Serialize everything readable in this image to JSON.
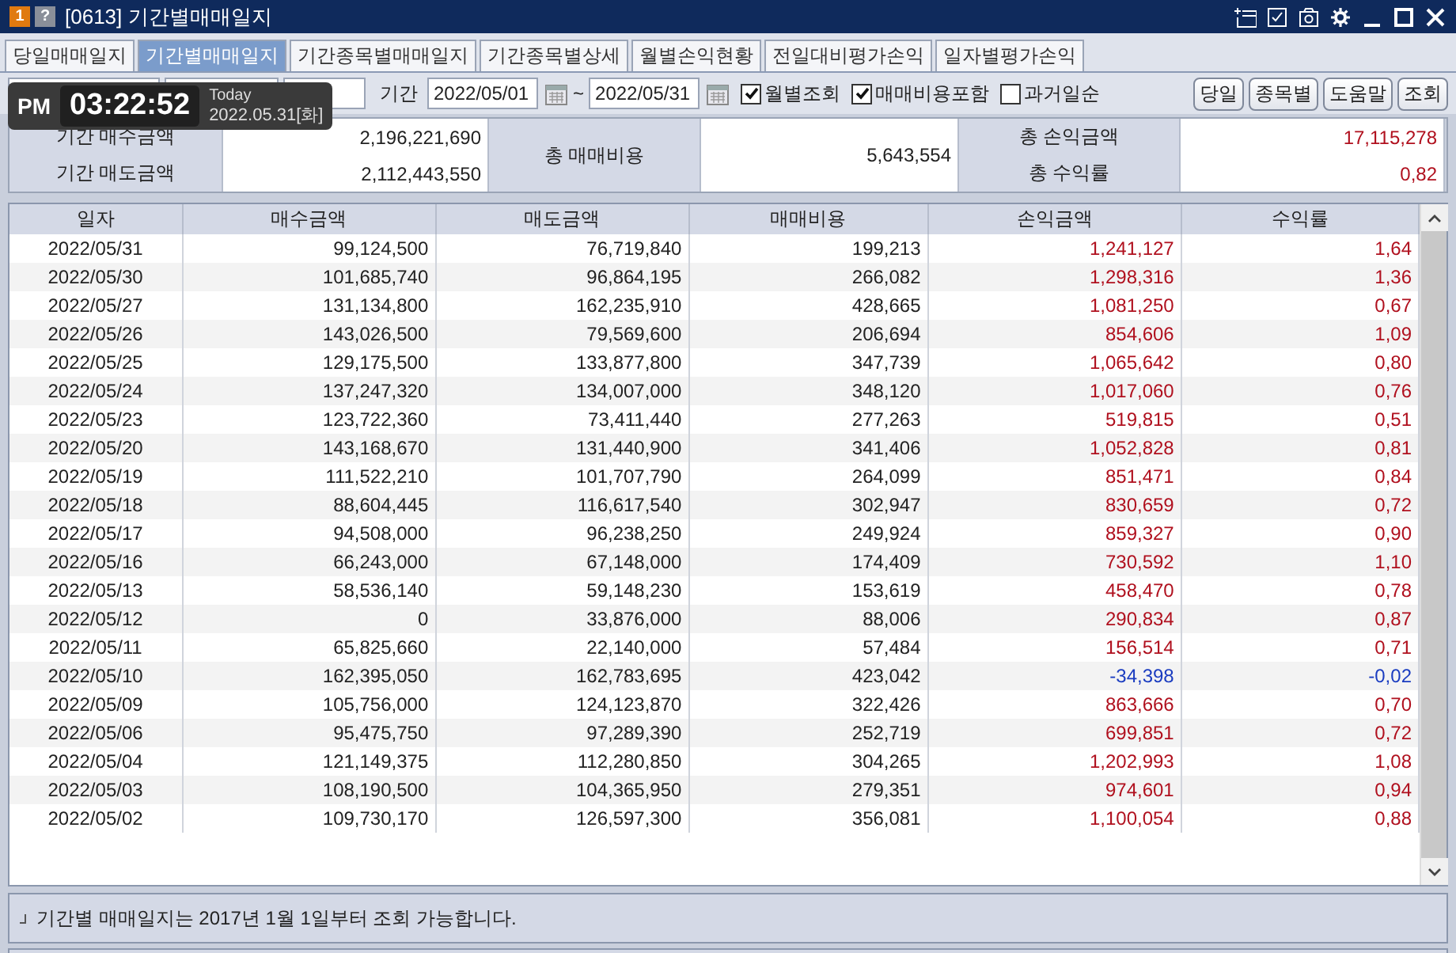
{
  "window": {
    "badge": "1",
    "help": "?",
    "title": "[0613] 기간별매매일지"
  },
  "tabs": [
    {
      "label": "당일매매일지",
      "selected": false
    },
    {
      "label": "기간별매매일지",
      "selected": true
    },
    {
      "label": "기간종목별매매일지",
      "selected": false
    },
    {
      "label": "기간종목별상세",
      "selected": false
    },
    {
      "label": "월별손익현황",
      "selected": false
    },
    {
      "label": "전일대비평가손익",
      "selected": false
    },
    {
      "label": "일자별평가손익",
      "selected": false
    }
  ],
  "clock": {
    "ampm": "PM",
    "time": "03:22:52",
    "caption": "Today",
    "date": "2022.05.31[화]"
  },
  "toolbar": {
    "period_label": "기간",
    "from": "2022/05/01",
    "separator": "~",
    "to": "2022/05/31",
    "checkboxes": [
      {
        "label": "월별조회",
        "checked": true
      },
      {
        "label": "매매비용포함",
        "checked": true
      },
      {
        "label": "과거일순",
        "checked": false
      }
    ],
    "buttons": [
      "당일",
      "종목별",
      "도움말",
      "조회"
    ]
  },
  "summary": {
    "buy_label": "기간 매수금액",
    "buy_value": "2,196,221,690",
    "sell_label": "기간 매도금액",
    "sell_value": "2,112,443,550",
    "cost_label": "총 매매비용",
    "cost_value": "5,643,554",
    "pnl_label": "총 손익금액",
    "pnl_value": "17,115,278",
    "rate_label": "총 수익률",
    "rate_value": "0,82",
    "loss": false
  },
  "table": {
    "columns": [
      "일자",
      "매수금액",
      "매도금액",
      "매매비용",
      "손익금액",
      "수익률"
    ],
    "rows": [
      {
        "cells": [
          "2022/05/31",
          "99,124,500",
          "76,719,840",
          "199,213",
          "1,241,127",
          "1,64"
        ],
        "loss": false
      },
      {
        "cells": [
          "2022/05/30",
          "101,685,740",
          "96,864,195",
          "266,082",
          "1,298,316",
          "1,36"
        ],
        "loss": false
      },
      {
        "cells": [
          "2022/05/27",
          "131,134,800",
          "162,235,910",
          "428,665",
          "1,081,250",
          "0,67"
        ],
        "loss": false
      },
      {
        "cells": [
          "2022/05/26",
          "143,026,500",
          "79,569,600",
          "206,694",
          "854,606",
          "1,09"
        ],
        "loss": false
      },
      {
        "cells": [
          "2022/05/25",
          "129,175,500",
          "133,877,800",
          "347,739",
          "1,065,642",
          "0,80"
        ],
        "loss": false
      },
      {
        "cells": [
          "2022/05/24",
          "137,247,320",
          "134,007,000",
          "348,120",
          "1,017,060",
          "0,76"
        ],
        "loss": false
      },
      {
        "cells": [
          "2022/05/23",
          "123,722,360",
          "73,411,440",
          "277,263",
          "519,815",
          "0,51"
        ],
        "loss": false
      },
      {
        "cells": [
          "2022/05/20",
          "143,168,670",
          "131,440,900",
          "341,406",
          "1,052,828",
          "0,81"
        ],
        "loss": false
      },
      {
        "cells": [
          "2022/05/19",
          "111,522,210",
          "101,707,790",
          "264,099",
          "851,471",
          "0,84"
        ],
        "loss": false
      },
      {
        "cells": [
          "2022/05/18",
          "88,604,445",
          "116,617,540",
          "302,947",
          "830,659",
          "0,72"
        ],
        "loss": false
      },
      {
        "cells": [
          "2022/05/17",
          "94,508,000",
          "96,238,250",
          "249,924",
          "859,327",
          "0,90"
        ],
        "loss": false
      },
      {
        "cells": [
          "2022/05/16",
          "66,243,000",
          "67,148,000",
          "174,409",
          "730,592",
          "1,10"
        ],
        "loss": false
      },
      {
        "cells": [
          "2022/05/13",
          "58,536,140",
          "59,148,230",
          "153,619",
          "458,470",
          "0,78"
        ],
        "loss": false
      },
      {
        "cells": [
          "2022/05/12",
          "0",
          "33,876,000",
          "88,006",
          "290,834",
          "0,87"
        ],
        "loss": false
      },
      {
        "cells": [
          "2022/05/11",
          "65,825,660",
          "22,140,000",
          "57,484",
          "156,514",
          "0,71"
        ],
        "loss": false
      },
      {
        "cells": [
          "2022/05/10",
          "162,395,050",
          "162,783,695",
          "423,042",
          "-34,398",
          "-0,02"
        ],
        "loss": true
      },
      {
        "cells": [
          "2022/05/09",
          "105,756,000",
          "124,123,870",
          "322,426",
          "863,666",
          "0,70"
        ],
        "loss": false
      },
      {
        "cells": [
          "2022/05/06",
          "95,475,750",
          "97,289,390",
          "252,719",
          "699,851",
          "0,72"
        ],
        "loss": false
      },
      {
        "cells": [
          "2022/05/04",
          "121,149,375",
          "112,280,850",
          "304,265",
          "1,202,993",
          "1,08"
        ],
        "loss": false
      },
      {
        "cells": [
          "2022/05/03",
          "108,190,500",
          "104,365,950",
          "279,351",
          "974,601",
          "0,94"
        ],
        "loss": false
      },
      {
        "cells": [
          "2022/05/02",
          "109,730,170",
          "126,597,300",
          "356,081",
          "1,100,054",
          "0,88"
        ],
        "loss": false
      }
    ]
  },
  "note": "기간별 매매일지는 2017년 1월 1일부터 조회 가능합니다."
}
